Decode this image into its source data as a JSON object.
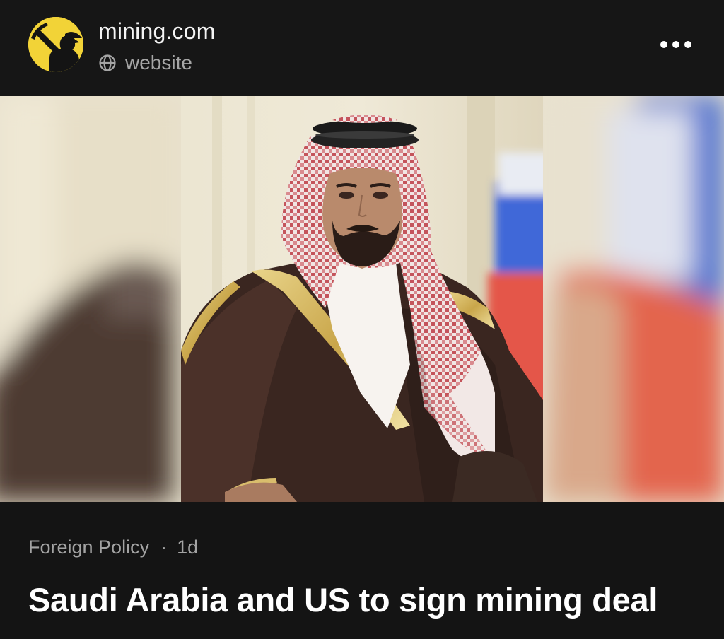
{
  "post": {
    "source_name": "mining.com",
    "source_type": "website",
    "source_type_icon": "globe-icon",
    "more_icon": "more-horizontal-icon",
    "avatar_icon": "mining-logo-icon",
    "colors": {
      "background": "#141414",
      "avatar_yellow": "#f2d337",
      "secondary_text": "#a6a6a6"
    }
  },
  "article": {
    "publisher": "Foreign Policy",
    "separator": "·",
    "age": "1d",
    "headline": "Saudi Arabia and US to sign mining deal",
    "image_subject": "portrait-photo"
  }
}
